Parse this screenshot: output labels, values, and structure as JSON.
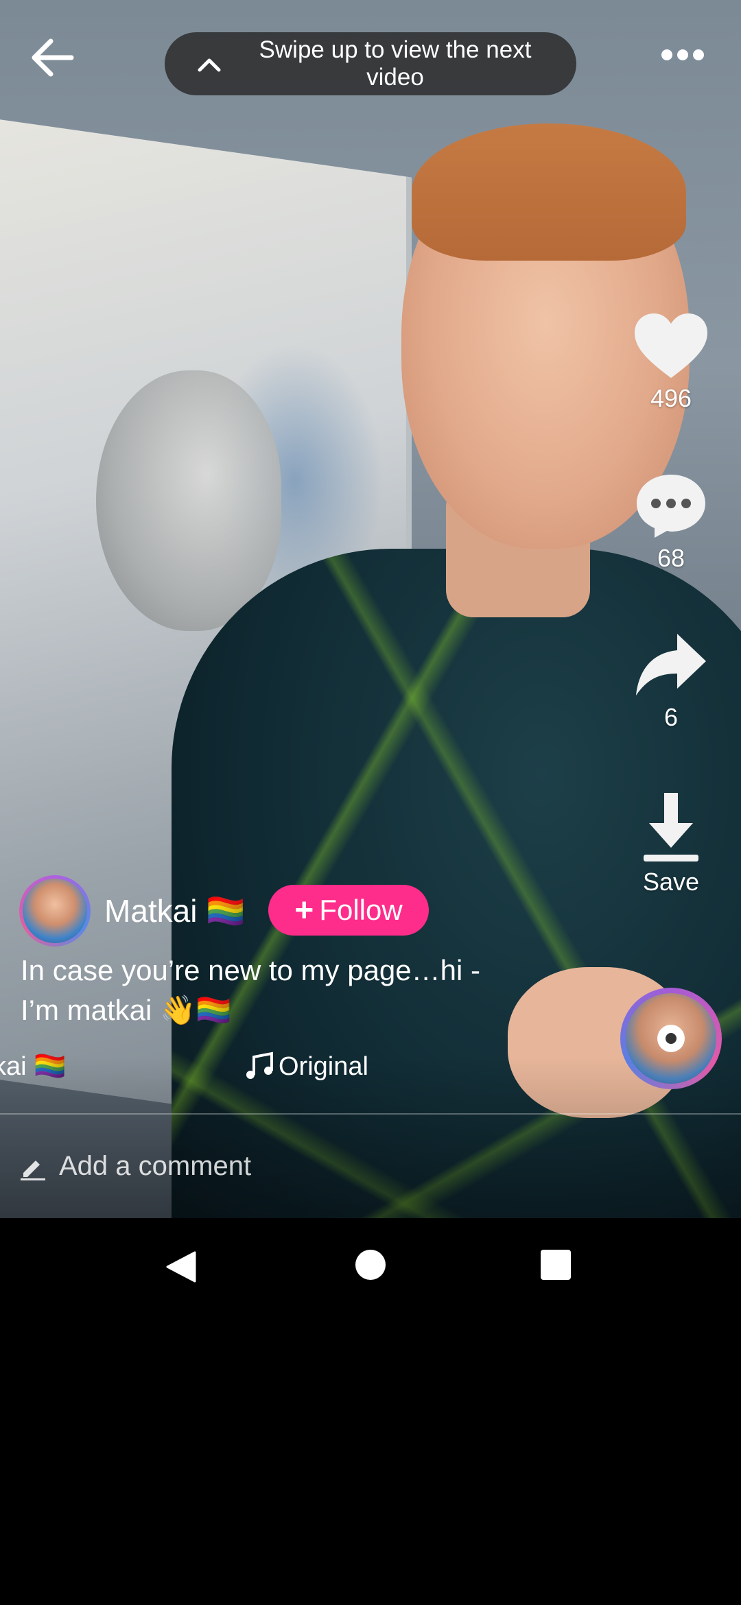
{
  "top_bar": {
    "swipe_hint": "Swipe up to view the next video",
    "icons": {
      "back": "arrow-left-icon",
      "more": "more-horizontal-icon",
      "hint": "chevron-up-icon"
    }
  },
  "rail": {
    "like_count": "496",
    "comment_count": "68",
    "share_count": "6",
    "save_label": "Save"
  },
  "author": {
    "name": "Matkai 🏳️‍🌈",
    "follow_label": "Follow"
  },
  "caption": {
    "line1": "In case you’re new to my page…hi -",
    "line2": "I’m matkai 👋🏳️‍🌈"
  },
  "ticker": {
    "author_tag": "kai 🏳️‍🌈",
    "music_label": "Original"
  },
  "comment_bar": {
    "placeholder": "Add a comment"
  },
  "colors": {
    "follow_button": "#fe2c8a",
    "pill_background": "#282828"
  }
}
